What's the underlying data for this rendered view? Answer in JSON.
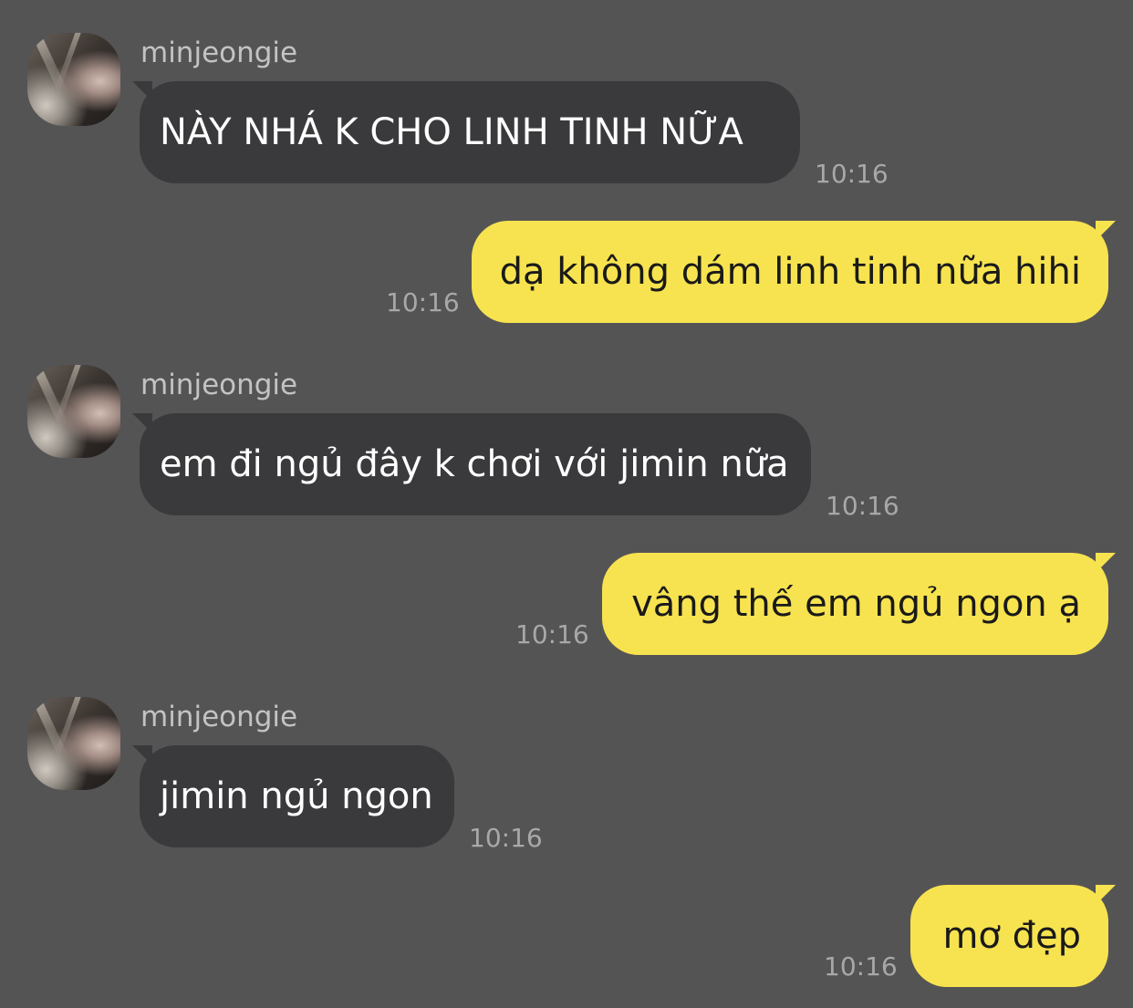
{
  "chat": {
    "contact_name": "minjeongie",
    "messages": [
      {
        "direction": "in",
        "text": "NÀY NHÁ K CHO LINH TINH NỮA",
        "time": "10:16"
      },
      {
        "direction": "out",
        "text": "dạ không dám linh tinh nữa hihi",
        "time": "10:16"
      },
      {
        "direction": "in",
        "text": "em đi ngủ đây k chơi với jimin nữa",
        "time": "10:16"
      },
      {
        "direction": "out",
        "text": "vâng thế em ngủ ngon ạ",
        "time": "10:16"
      },
      {
        "direction": "in",
        "text": "jimin ngủ ngon",
        "time": "10:16"
      },
      {
        "direction": "out",
        "text": "mơ đẹp",
        "time": "10:16"
      }
    ]
  },
  "colors": {
    "background": "#555455",
    "incoming_bubble": "#3a393b",
    "outgoing_bubble": "#f7e34f",
    "timestamp": "#a9a8a9",
    "sender_name": "#c4c3c4"
  }
}
